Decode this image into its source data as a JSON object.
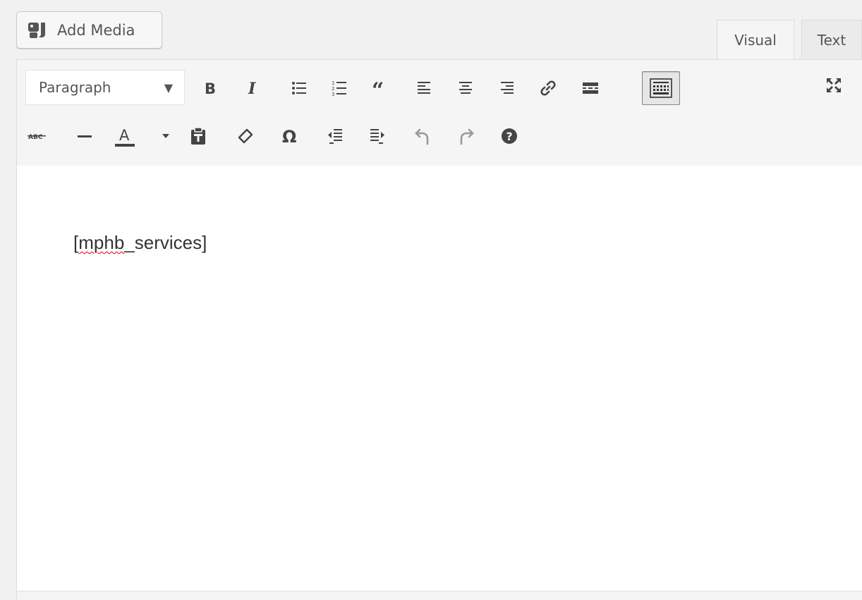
{
  "media": {
    "add_media_label": "Add Media"
  },
  "tabs": [
    {
      "label": "Visual",
      "active": true
    },
    {
      "label": "Text",
      "active": false
    }
  ],
  "toolbar": {
    "format_select": {
      "value": "Paragraph"
    },
    "row1_icons": [
      "bold-icon",
      "italic-icon",
      "bulleted-list-icon",
      "numbered-list-icon",
      "blockquote-icon",
      "align-left-icon",
      "align-center-icon",
      "align-right-icon",
      "insert-link-icon",
      "read-more-icon",
      "toolbar-toggle-icon",
      "fullscreen-icon"
    ],
    "row2_icons": [
      "strikethrough-icon",
      "horizontal-line-icon",
      "text-color-icon",
      "text-color-dropdown-icon",
      "paste-as-text-icon",
      "clear-formatting-icon",
      "special-character-icon",
      "outdent-icon",
      "indent-icon",
      "undo-icon",
      "redo-icon",
      "help-icon"
    ]
  },
  "content": {
    "shortcode_open": "[",
    "shortcode_misspelled": "mphb",
    "shortcode_rest": "_services]"
  },
  "colors": {
    "toolbar_bg": "#f5f5f5",
    "spellcheck_underline": "#e00000",
    "text_color_bar": "#444444"
  }
}
